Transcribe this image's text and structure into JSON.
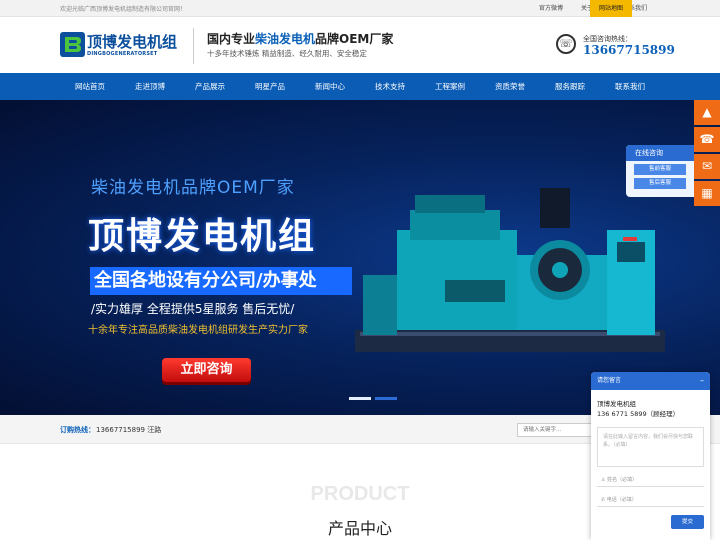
{
  "topbar": {
    "welcome": "欢迎光临广西顶博发电机组制造有限公司官网！",
    "links": [
      "官方微博",
      "关于我们",
      "联系我们"
    ],
    "sitemap": "网站地图"
  },
  "header": {
    "logo_cn": "顶博发电机组",
    "logo_en": "DINGBOGENERATORSET",
    "slogan_pre": "国内专业",
    "slogan_hl": "柴油发电机",
    "slogan_post": "品牌OEM厂家",
    "slogan_sub": "十多年技术锤炼  精益制造、经久耐用、安全稳定",
    "hotline_label": "全国咨询热线：",
    "hotline_number": "13667715899"
  },
  "nav": [
    "网站首页",
    "走进顶博",
    "产品展示",
    "明星产品",
    "新闻中心",
    "技术支持",
    "工程案例",
    "资质荣誉",
    "服务跟踪",
    "联系我们"
  ],
  "banner": {
    "line1": "柴油发电机品牌OEM厂家",
    "title": "顶博发电机组",
    "box": "全国各地设有分公司/办事处",
    "sub": "/实力雄厚 全程提供5星服务 售后无忧/",
    "sub2": "十余年专注高品质柴油发电机组研发生产实力厂家",
    "button": "立即咨询"
  },
  "online_chat": {
    "title": "在线咨询",
    "items": [
      "售前客服",
      "售后客服"
    ]
  },
  "search_bar": {
    "label": "订购热线：",
    "value": "13667715899 汪路",
    "placeholder": "请输入关键字..."
  },
  "products": {
    "en": "PRODUCT",
    "cn": "产品中心"
  },
  "message_box": {
    "title": "请您留言",
    "company": "顶博发电机组",
    "contact": "136 6771 5899（顾经理）",
    "textarea_placeholder": "请在此输入留言内容，我们会尽快与您联系。（必填）",
    "name_placeholder": "姓名（必填）",
    "phone_placeholder": "电话（必填）",
    "submit": "提交"
  },
  "colors": {
    "brand_blue": "#0b5cb5",
    "accent_orange": "#f06b15",
    "sitemap_yellow": "#f5b800"
  }
}
